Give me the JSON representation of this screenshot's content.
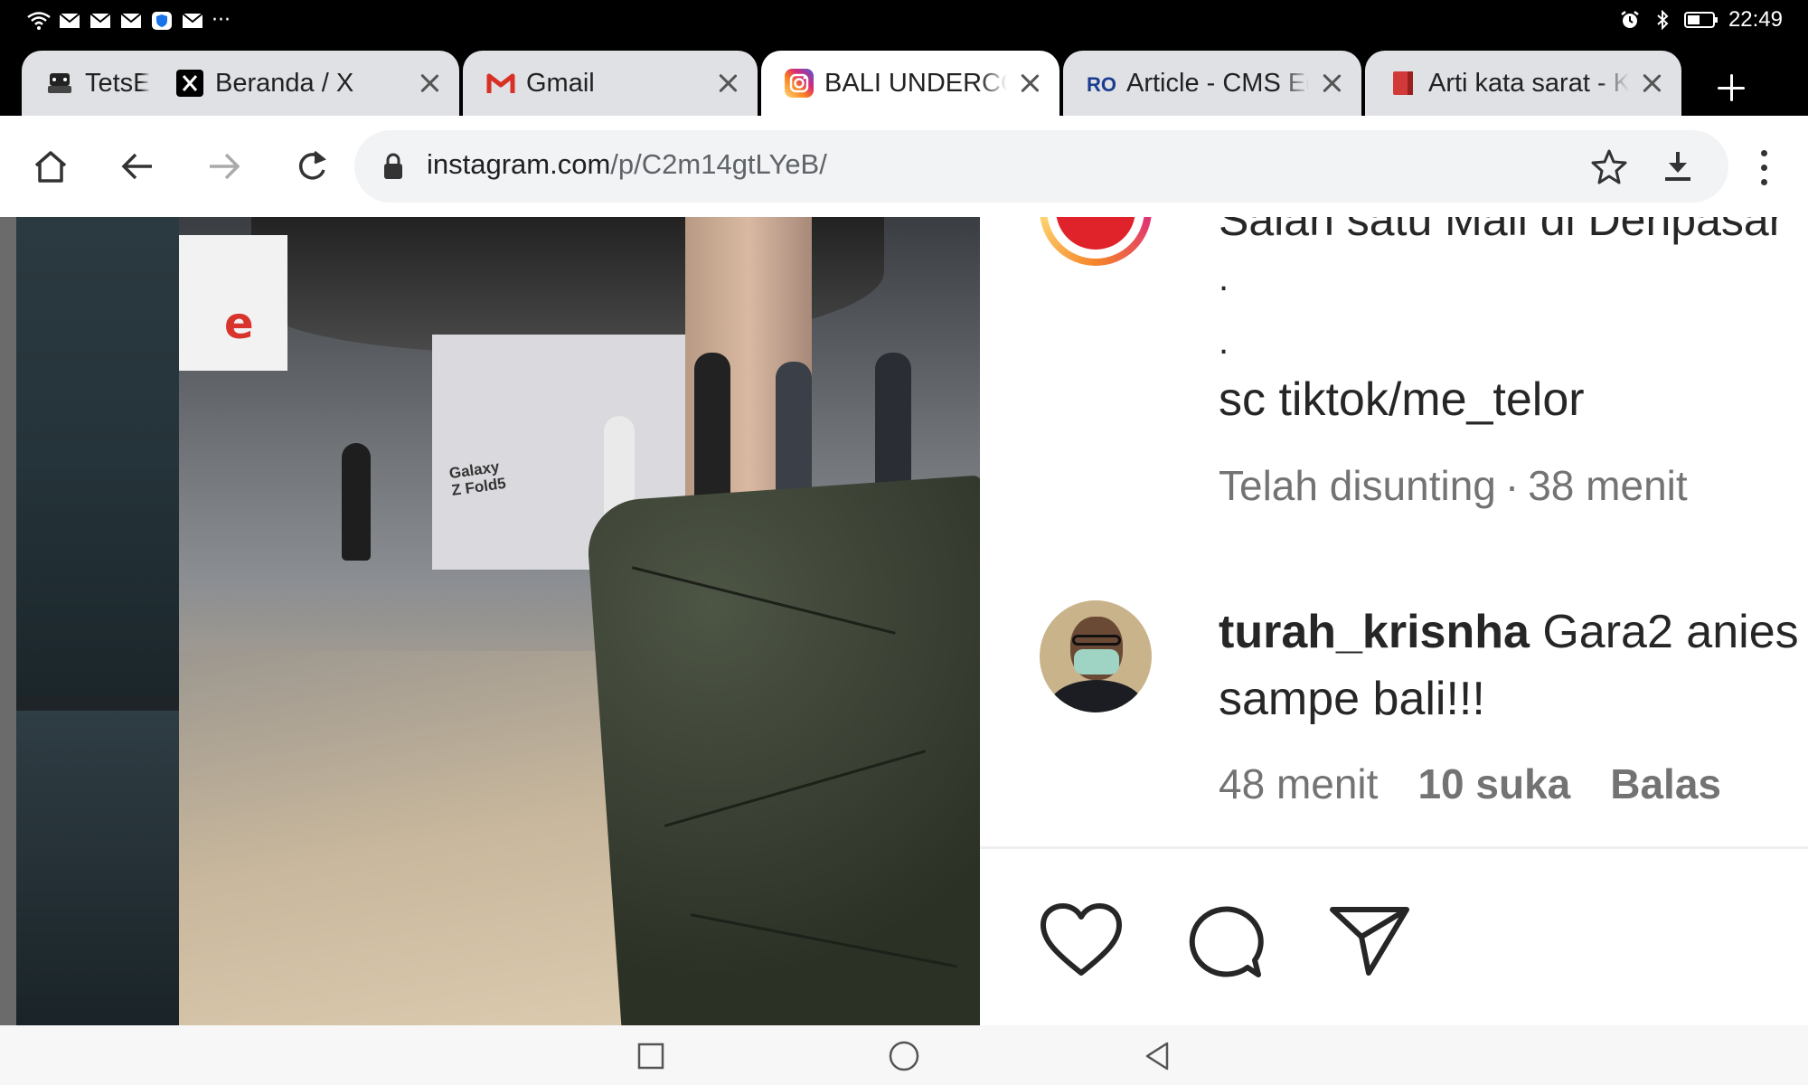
{
  "status_bar": {
    "time": "22:49",
    "overflow": "···",
    "left_icons": [
      "wifi-icon",
      "mail-icon",
      "mail-icon",
      "mail-icon",
      "shield-icon",
      "mail-icon"
    ],
    "right_icons": [
      "alarm-icon",
      "bluetooth-icon",
      "battery-icon"
    ]
  },
  "tabs": [
    {
      "title": "TetsEl",
      "favicon": "tetsel-favicon",
      "active": false
    },
    {
      "title": "Beranda / X",
      "favicon": "x-favicon",
      "active": false
    },
    {
      "title": "Gmail",
      "favicon": "gmail-favicon",
      "active": false
    },
    {
      "title": "BALI UNDERCOVER",
      "favicon": "instagram-favicon",
      "active": true
    },
    {
      "title": "Article - CMS Editor",
      "favicon": "ro-favicon",
      "active": false
    },
    {
      "title": "Arti kata sarat - KBBI",
      "favicon": "book-favicon",
      "active": false
    }
  ],
  "omnibox": {
    "domain": "instagram.com",
    "path": "/p/C2m14gtLYeB/"
  },
  "post": {
    "caption_cut": "Salah satu Mall di Denpasar",
    "dots": [
      ".",
      "."
    ],
    "caption_line": "sc tiktok/me_telor",
    "edited_label": "Telah disunting",
    "separator": "·",
    "edited_time": "38 menit"
  },
  "photo": {
    "store_logo": "e",
    "sign_lines": [
      "Galaxy",
      "Z Fold5"
    ]
  },
  "comment": {
    "username": "turah_krisnha",
    "text": " Gara2 anies sampe bali!!!",
    "time": "48 menit",
    "likes": "10 suka",
    "reply": "Balas"
  },
  "actions": [
    "heart-icon",
    "comment-icon",
    "share-icon"
  ],
  "nav": [
    "recents-icon",
    "home-icon",
    "back-icon"
  ]
}
